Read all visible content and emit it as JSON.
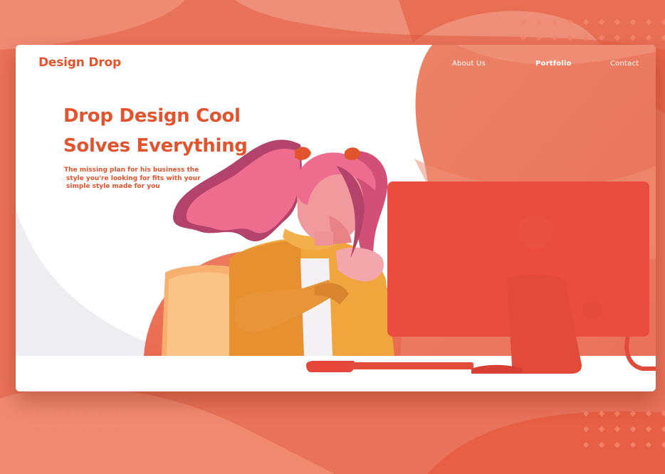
{
  "brand": "Design Drop",
  "nav": [
    {
      "label": "About Us",
      "active": false
    },
    {
      "label": "Portfolio",
      "active": true
    },
    {
      "label": "Contact",
      "active": false
    }
  ],
  "hero": {
    "headline_line1": "Drop  Design Cool",
    "headline_line2": "Solves Everything",
    "subtext_lines": [
      "The missing plan for  his business the",
      "style you're looking for fits with your",
      "simple style made for you"
    ]
  },
  "colors": {
    "accent": "#e2542e",
    "background": "#e9735a",
    "monitor": "#e6453a",
    "sweater": "#f0a63c",
    "hair": "#ee6d8f"
  },
  "illustration": {
    "subject": "girl-with-pink-pigtails-at-computer",
    "icons": [
      "monitor-icon"
    ]
  }
}
